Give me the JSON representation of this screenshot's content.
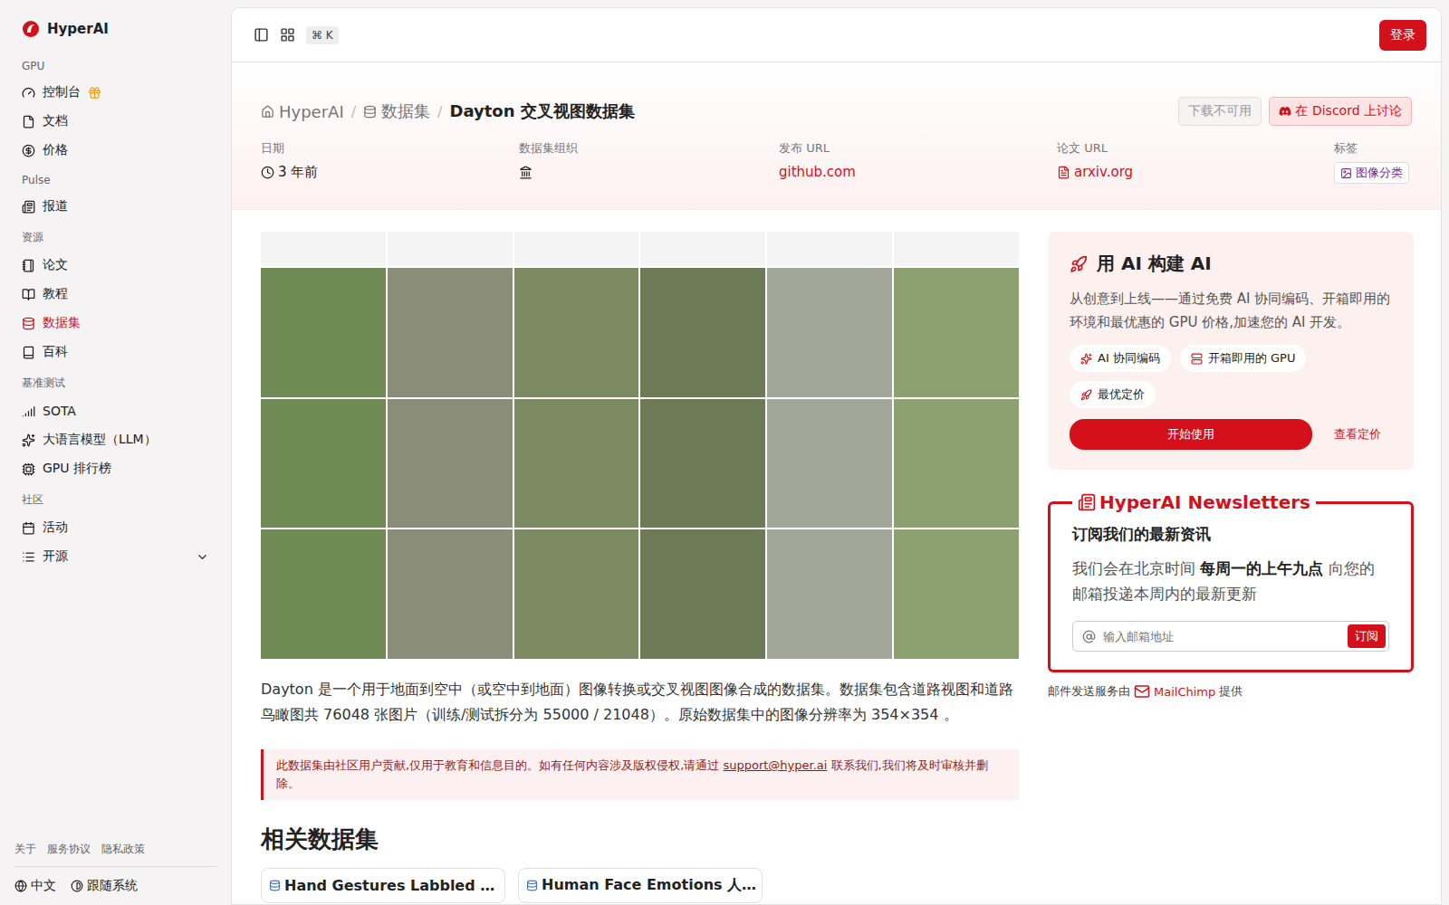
{
  "logo": "HyperAI",
  "sidebar": {
    "sections": [
      {
        "title": "GPU",
        "items": [
          {
            "label": "控制台",
            "selected": false,
            "badge": true
          },
          {
            "label": "文档",
            "selected": false,
            "badge": false
          },
          {
            "label": "价格",
            "selected": false,
            "badge": false
          }
        ]
      },
      {
        "title": "Pulse",
        "items": [
          {
            "label": "报道",
            "selected": false,
            "badge": false
          }
        ]
      },
      {
        "title": "资源",
        "items": [
          {
            "label": "论文",
            "selected": false,
            "badge": false
          },
          {
            "label": "教程",
            "selected": false,
            "badge": false
          },
          {
            "label": "数据集",
            "selected": true,
            "badge": false
          },
          {
            "label": "百科",
            "selected": false,
            "badge": false
          }
        ]
      },
      {
        "title": "基准测试",
        "items": [
          {
            "label": "SOTA",
            "selected": false,
            "badge": false
          },
          {
            "label": "大语言模型（LLM）",
            "selected": false,
            "badge": false
          },
          {
            "label": "GPU 排行榜",
            "selected": false,
            "badge": false
          }
        ]
      },
      {
        "title": "社区",
        "items": [
          {
            "label": "活动",
            "selected": false,
            "badge": false
          },
          {
            "label": "开源",
            "selected": false,
            "badge": false,
            "expanded": false
          }
        ]
      }
    ],
    "footer_links": [
      "关于",
      "服务协议",
      "隐私政策"
    ],
    "language": "中文",
    "theme": "跟随系统"
  },
  "topbar": {
    "shortcut": "⌘ K",
    "login": "登录"
  },
  "breadcrumbs": [
    "HyperAI",
    "数据集",
    "Dayton 交叉视图数据集"
  ],
  "actions": [
    {
      "label": "下载不可用",
      "disabled": true
    },
    {
      "label": "在 Discord 上讨论",
      "disabled": false
    }
  ],
  "meta": [
    {
      "label": "日期",
      "value": "3 年前"
    },
    {
      "label": "数据集组织",
      "value": ""
    },
    {
      "label": "发布 URL",
      "value": "github.com"
    },
    {
      "label": "论文 URL",
      "value": "arxiv.org"
    },
    {
      "label": "标签",
      "value": "图像分类"
    }
  ],
  "description": "Dayton 是一个用于地面到空中（或空中到地面）图像转换或交叉视图图像合成的数据集。数据集包含道路视图和道路鸟瞰图共 76048 张图片（训练/测试拆分为 55000 / 21048）。原始数据集中的图像分辨率为 354×354 。",
  "notice": {
    "before": "此数据集由社区用户贡献,仅用于教育和信息目的。如有任何内容涉及版权侵权,请通过 ",
    "email": "support@hyper.ai",
    "after": " 联系我们,我们将及时审核并删除。"
  },
  "related": {
    "title": "相关数据集",
    "cards": [
      "Hand Gestures Labbled …",
      "Human Face Emotions 人…"
    ]
  },
  "promo": {
    "title": "用 AI 构建 AI",
    "text": "从创意到上线——通过免费 AI 协同编码、开箱即用的环境和最优惠的 GPU 价格,加速您的 AI 开发。",
    "features": [
      "AI 协同编码",
      "开箱即用的 GPU",
      "最优定价"
    ],
    "primary": "开始使用",
    "secondary": "查看定价"
  },
  "newsletter": {
    "title": "HyperAI Newsletters",
    "heading": "订阅我们的最新资讯",
    "text_before": "我们会在北京时间 ",
    "text_bold": "每周一的上午九点",
    "text_after": " 向您的邮箱投递本周内的最新更新",
    "placeholder": "输入邮箱地址",
    "button": "订阅",
    "footer_before": "邮件发送服务由 ",
    "footer_brand": "MailChimp",
    "footer_after": " 提供"
  }
}
